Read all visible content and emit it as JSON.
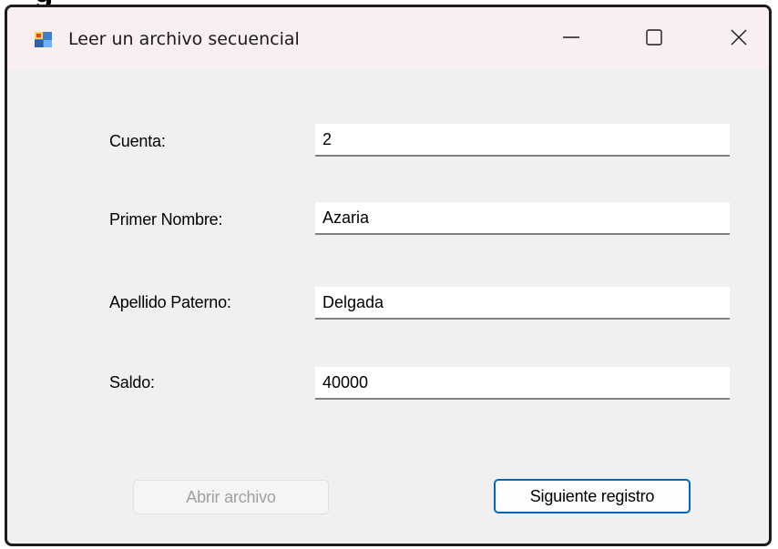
{
  "page": {
    "top_clipped_text": "g"
  },
  "window": {
    "title": "Leer un archivo secuencial",
    "app_icon": "windows-forms-app-icon",
    "controls": {
      "minimize_icon": "minimize-icon",
      "maximize_icon": "maximize-icon",
      "close_icon": "close-icon"
    }
  },
  "form": {
    "fields": [
      {
        "label": "Cuenta:",
        "value": "2"
      },
      {
        "label": "Primer Nombre:",
        "value": "Azaria"
      },
      {
        "label": "Apellido Paterno:",
        "value": "Delgada"
      },
      {
        "label": "Saldo:",
        "value": "40000"
      }
    ],
    "buttons": {
      "open_label": "Abrir archivo",
      "open_enabled": false,
      "next_label": "Siguiente registro",
      "next_enabled": true
    }
  },
  "colors": {
    "titlebar": "#f9eff1",
    "form_background": "#f0f0f0",
    "accent_border": "#0067c0",
    "disabled_text": "#a0a0a0"
  }
}
